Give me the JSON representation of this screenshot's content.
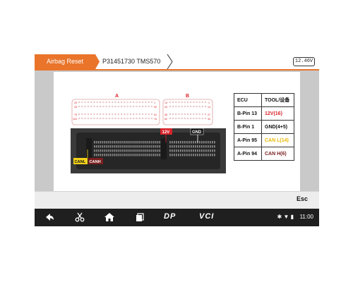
{
  "header": {
    "tab_label": "Airbag Reset",
    "crumb_label": "P31451730 TMS570",
    "voltage": "12.46V"
  },
  "diagram": {
    "connector_a_label": "A",
    "connector_b_label": "B",
    "a_row1_left": "25",
    "a_row1_right": "1",
    "a_row2_left": "26",
    "a_row2_right": "50",
    "a_row3_left": "75",
    "a_row3_right": "51",
    "a_row4_left": "100",
    "a_row4_right": "76",
    "b_row1_left": "13",
    "b_row1_right": "1",
    "b_row2_left": "26",
    "b_row2_right": "14",
    "b_row3_left": "38",
    "b_row3_right": "27",
    "b_row4_left": "52",
    "b_row4_right": "40",
    "tag_12v": "12V",
    "tag_gnd": "GND",
    "tag_canl": "CANL",
    "tag_canh": "CANH",
    "colors": {
      "red": "#d8232a",
      "yellow": "#f2d21b",
      "dark": "#111111"
    }
  },
  "table": {
    "header_ecu": "ECU",
    "header_tool": "TOOL/设备",
    "rows": [
      {
        "ecu": "B-Pin 13",
        "tool": "12V(16)",
        "color": "red"
      },
      {
        "ecu": "B-Pin 1",
        "tool": "GND(4+5)",
        "color": "dark"
      },
      {
        "ecu": "A-Pin 95",
        "tool": "CAN L(14)",
        "color": "yellow"
      },
      {
        "ecu": "A-Pin 94",
        "tool": "CAN H(6)",
        "color": "dark"
      }
    ]
  },
  "actionbar": {
    "esc_label": "Esc"
  },
  "navbar": {
    "icons": [
      "back-icon",
      "scissors-icon",
      "home-icon",
      "recent-apps-icon"
    ],
    "dp_label": "DP",
    "vci_label": "VCI",
    "status_icons": "✱ ▼ ▮",
    "time": "11:00"
  }
}
